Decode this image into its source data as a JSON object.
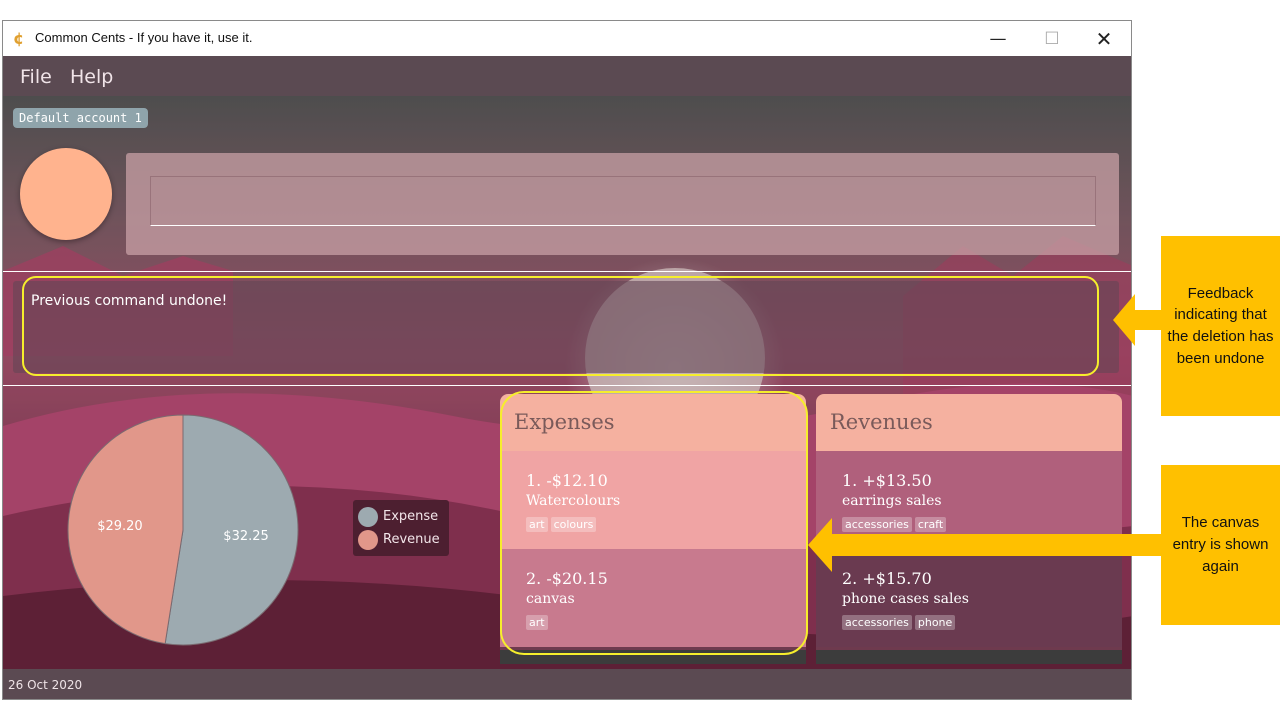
{
  "window": {
    "title": "Common Cents - If you have it, use it.",
    "controls": {
      "minimize": "—",
      "maximize": "☐",
      "close": "✕"
    }
  },
  "menu": {
    "file": "File",
    "help": "Help"
  },
  "account": {
    "name": "Default account 1"
  },
  "command": {
    "value": ""
  },
  "result": {
    "message": "Previous command undone!"
  },
  "pie": {
    "slices": [
      {
        "name": "Expense",
        "value": 32.25,
        "label": "$32.25",
        "color": "#9daab0"
      },
      {
        "name": "Revenue",
        "value": 29.2,
        "label": "$29.20",
        "color": "#e1978a"
      }
    ]
  },
  "legend": {
    "expense": "Expense",
    "revenue": "Revenue"
  },
  "expenses": {
    "title": "Expenses",
    "items": [
      {
        "title": "1.  -$12.10",
        "desc": "Watercolours",
        "tags": [
          "art",
          "colours"
        ]
      },
      {
        "title": "2.  -$20.15",
        "desc": "canvas",
        "tags": [
          "art"
        ]
      }
    ]
  },
  "revenues": {
    "title": "Revenues",
    "items": [
      {
        "title": "1.  +$13.50",
        "desc": "earrings sales",
        "tags": [
          "accessories",
          "craft"
        ]
      },
      {
        "title": "2.  +$15.70",
        "desc": "phone cases sales",
        "tags": [
          "accessories",
          "phone"
        ]
      }
    ]
  },
  "status": {
    "date": "26 Oct 2020"
  },
  "annotations": {
    "feedback_note": "Feedback indicating that the deletion has been undone",
    "canvas_note": "The canvas entry is shown again",
    "highlight_color": "#f6ee2c",
    "note_color": "#ffc000"
  }
}
